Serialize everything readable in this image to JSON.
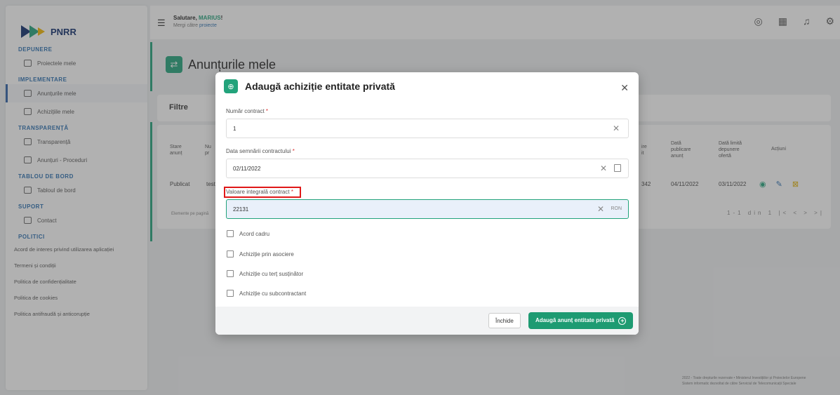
{
  "app": {
    "logo": "PNRR"
  },
  "sidebar": {
    "sections": {
      "depunere": "DEPUNERE",
      "implementare": "IMPLEMENTARE",
      "transparenta": "TRANSPARENȚĂ",
      "tablou": "TABLOU DE BORD",
      "suport": "SUPORT",
      "politici": "POLITICI"
    },
    "items": {
      "proiectele": "Proiectele mele",
      "anunturile": "Anunțurile mele",
      "achizitiile": "Achizițiile mele",
      "transparenta": "Transparență",
      "anunturi_proceduri": "Anunțuri - Proceduri",
      "tablou": "Tabloul de bord",
      "contact": "Contact"
    },
    "policies": [
      "Acord de interes privind utilizarea aplicației",
      "Termeni și condiții",
      "Politica de confidențialitate",
      "Politica de cookies",
      "Politica antifraudă și anticorupție"
    ]
  },
  "topbar": {
    "greeting": "Salutare, ",
    "user": "MARIUS",
    "greeting_end": "!",
    "nav_prefix": "Mergi către ",
    "nav_link": "proiecte"
  },
  "page": {
    "title": "Anunțurile mele",
    "filters": "Filtre",
    "table": {
      "h1": "Stare anunț",
      "h2": "Nu pr",
      "h3": "ire it",
      "h4": "Dată publicare anunț",
      "h5": "Dată limită depunere ofertă",
      "h6": "Acțiuni",
      "row_status": "Publicat",
      "row_name": "test",
      "row_code": "342",
      "row_pub": "04/11/2022",
      "row_deadline": "03/11/2022",
      "per_page": "Elemente pe pagină",
      "pagination": "1-1 din 1"
    },
    "footer": {
      "line1": "2022 - Toate drepturile rezervate • Ministerul Investițiilor și Proiectelor Europene",
      "line2": "Sistem informatic dezvoltat de către Serviciul de Telecomunicații Speciale"
    }
  },
  "modal": {
    "title": "Adaugă achiziție entitate privată",
    "contract_number_label": "Număr contract",
    "contract_number_value": "1",
    "sign_date_label": "Data semnării contractului",
    "sign_date_value": "02/11/2022",
    "value_label": "Valoare integrală contract",
    "value_value": "22131",
    "currency": "RON",
    "required_mark": "*",
    "checkboxes": [
      "Acord cadru",
      "Achiziție prin asociere",
      "Achiziție cu terț susținător",
      "Achiziție cu subcontractant"
    ],
    "close_btn": "Închide",
    "add_btn": "Adaugă anunț entitate privată"
  },
  "colors": {
    "accent": "#22a37b",
    "highlight": "#e01818",
    "brand": "#0d2b6b"
  }
}
